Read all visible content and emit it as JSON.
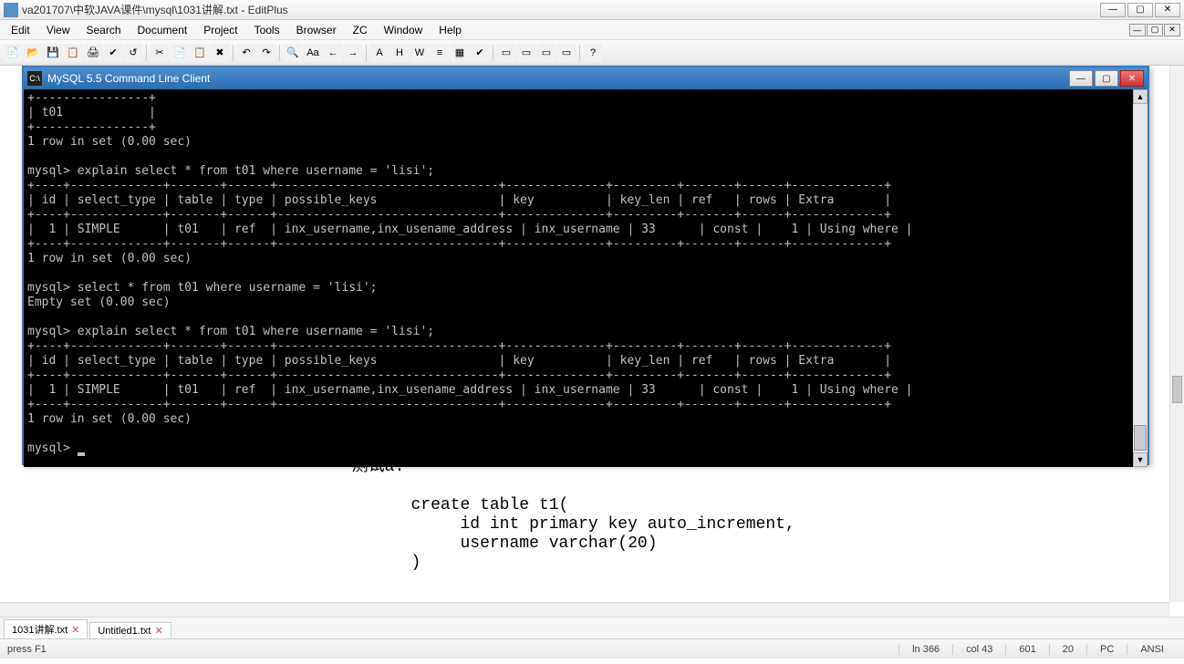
{
  "titlebar": {
    "title": "va201707\\中软JAVA课件\\mysql\\1031讲解.txt - EditPlus"
  },
  "menu": {
    "items": [
      "Edit",
      "View",
      "Search",
      "Document",
      "Project",
      "Tools",
      "Browser",
      "ZC",
      "Window",
      "Help"
    ]
  },
  "toolbar": {
    "glyphs": [
      "📄",
      "📂",
      "💾",
      "📋",
      "🖨",
      "✔",
      "↺",
      "✂",
      "📄",
      "📋",
      "✖",
      "↶",
      "↷",
      "🔍",
      "Aa",
      "←",
      "→",
      "A",
      "H",
      "W",
      "≡",
      "▦",
      "✔",
      "▭",
      "▭",
      "▭",
      "▭",
      "?"
    ]
  },
  "console": {
    "title": "MySQL 5.5 Command Line Client",
    "text": "+----------------+\n| t01            |\n+----------------+\n1 row in set (0.00 sec)\n\nmysql> explain select * from t01 where username = 'lisi';\n+----+-------------+-------+------+-------------------------------+--------------+---------+-------+------+-------------+\n| id | select_type | table | type | possible_keys                 | key          | key_len | ref   | rows | Extra       |\n+----+-------------+-------+------+-------------------------------+--------------+---------+-------+------+-------------+\n|  1 | SIMPLE      | t01   | ref  | inx_username,inx_usename_address | inx_username | 33      | const |    1 | Using where |\n+----+-------------+-------+------+-------------------------------+--------------+---------+-------+------+-------------+\n1 row in set (0.00 sec)\n\nmysql> select * from t01 where username = 'lisi';\nEmpty set (0.00 sec)\n\nmysql> explain select * from t01 where username = 'lisi';\n+----+-------------+-------+------+-------------------------------+--------------+---------+-------+------+-------------+\n| id | select_type | table | type | possible_keys                 | key          | key_len | ref   | rows | Extra       |\n+----+-------------+-------+------+-------------------------------+--------------+---------+-------+------+-------------+\n|  1 | SIMPLE      | t01   | ref  | inx_username,inx_usename_address | inx_username | 33      | const |    1 | Using where |\n+----+-------------+-------+------+-------------------------------+--------------+---------+-------+------+-------------+\n1 row in set (0.00 sec)\n\nmysql> "
  },
  "editor": {
    "lines": "                                测试a.\n\n                                      create table t1(\n                                           id int primary key auto_increment,\n                                           username varchar(20)\n                                      )"
  },
  "tabs": {
    "items": [
      {
        "label": "1031讲解.txt",
        "active": true
      },
      {
        "label": "Untitled1.txt",
        "active": false
      }
    ]
  },
  "status": {
    "help": "press F1",
    "ln": "ln 366",
    "col": "col 43",
    "lines": "601",
    "sel": "20",
    "mode": "PC",
    "enc": "ANSI"
  }
}
